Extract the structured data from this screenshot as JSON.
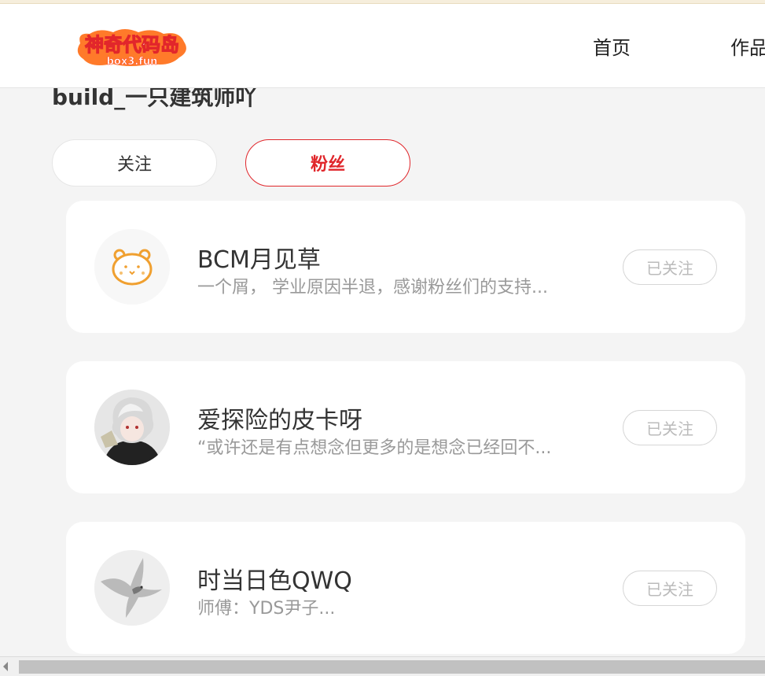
{
  "header": {
    "logo_text": "神奇代码岛",
    "logo_subtext": "box3.fun",
    "nav": {
      "home": "首页",
      "works": "作品"
    }
  },
  "profile": {
    "username": "build_一只建筑师吖"
  },
  "tabs": {
    "follow": "关注",
    "fans": "粉丝",
    "active": "fans"
  },
  "fans": [
    {
      "name": "BCM月见草",
      "bio": "一个屑， 学业原因半退，感谢粉丝们的支持...",
      "button": "已关注",
      "avatar": "bear-avatar-icon"
    },
    {
      "name": "爱探险的皮卡呀",
      "bio": "“或许还是有点想念但更多的是想念已经回不...",
      "button": "已关注",
      "avatar": "anime-character-avatar"
    },
    {
      "name": "时当日色QWQ",
      "bio": "师傅：YDS尹子...",
      "button": "已关注",
      "avatar": "bird-avatar"
    }
  ],
  "colors": {
    "accent": "#e0262b",
    "background": "#f4f4f4"
  }
}
